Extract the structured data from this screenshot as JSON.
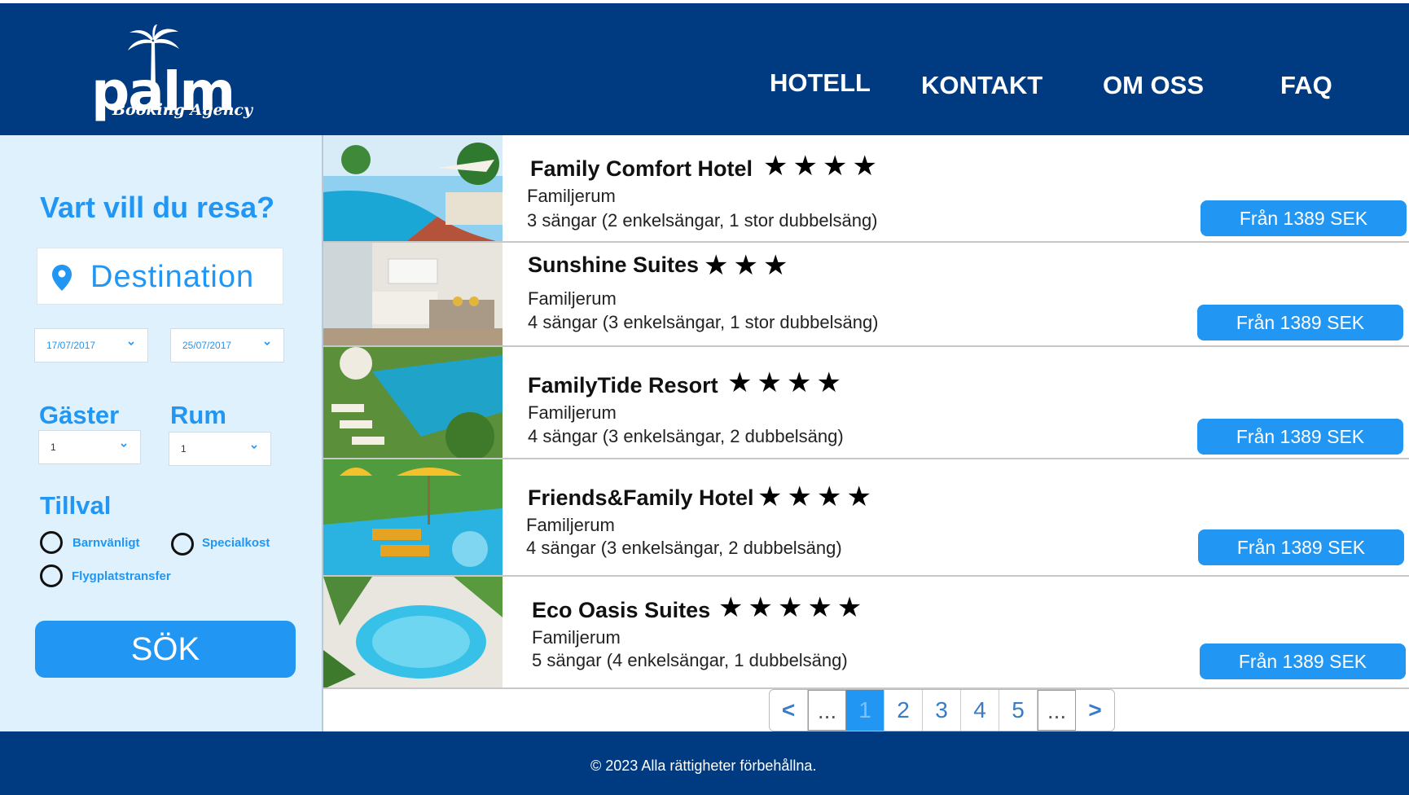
{
  "header": {
    "logo_main": "palm",
    "logo_sub": "Booking Agency",
    "nav": [
      "HOTELL",
      "KONTAKT",
      "OM OSS",
      "FAQ"
    ]
  },
  "search": {
    "title": "Vart vill du resa?",
    "destination_placeholder": "Destination",
    "date_from": "17/07/2017",
    "date_to": "25/07/2017",
    "guests_label": "Gäster",
    "guests_value": "1",
    "rooms_label": "Rum",
    "rooms_value": "1",
    "extras_label": "Tillval",
    "extras": [
      "Barnvänligt",
      "Specialkost",
      "Flygplatstransfer"
    ],
    "button_label": "SÖK"
  },
  "hotels": [
    {
      "name": "Family Comfort Hotel",
      "stars": 4,
      "room": "Familjerum",
      "beds": "3 sängar (2 enkelsängar, 1 stor dubbelsäng)",
      "price": "Från 1389 SEK"
    },
    {
      "name": "Sunshine Suites",
      "stars": 3,
      "room": "Familjerum",
      "beds": "4 sängar (3 enkelsängar, 1 stor dubbelsäng)",
      "price": "Från 1389 SEK"
    },
    {
      "name": "FamilyTide Resort",
      "stars": 4,
      "room": "Familjerum",
      "beds": "4 sängar (3 enkelsängar, 2 dubbelsäng)",
      "price": "Från 1389 SEK"
    },
    {
      "name": "Friends&Family Hotel",
      "stars": 4,
      "room": "Familjerum",
      "beds": "4 sängar (3 enkelsängar, 2 dubbelsäng)",
      "price": "Från 1389 SEK"
    },
    {
      "name": "Eco Oasis Suites",
      "stars": 5,
      "room": "Familjerum",
      "beds": "5 sängar (4 enkelsängar, 1 dubbelsäng)",
      "price": "Från 1389 SEK"
    }
  ],
  "pagination": {
    "prev": "<",
    "ellipsis": "...",
    "pages": [
      "1",
      "2",
      "3",
      "4",
      "5"
    ],
    "current": "1",
    "next": ">"
  },
  "footer": {
    "copyright": "© 2023 Alla rättigheter förbehållna."
  },
  "colors": {
    "header_bg": "#003a80",
    "accent": "#2196f3",
    "sidebar_bg": "#dff1fc"
  }
}
